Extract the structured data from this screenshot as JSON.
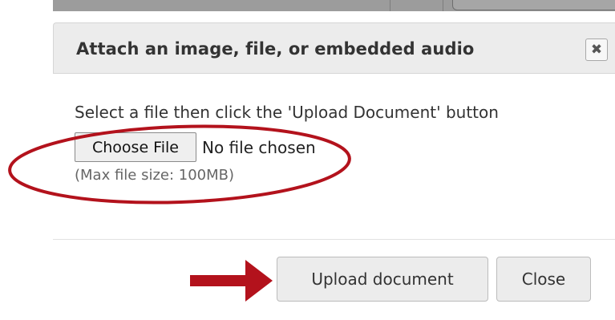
{
  "dialog": {
    "title": "Attach an image, file, or embedded audio",
    "close_icon_glyph": "✖"
  },
  "upload": {
    "instruction": "Select a file then click the 'Upload Document' button",
    "choose_file_label": "Choose File",
    "no_file_text": "No file chosen",
    "max_size_text": "(Max file size: 100MB)"
  },
  "footer": {
    "upload_label": "Upload document",
    "close_label": "Close"
  },
  "icons": {
    "close": "close-icon",
    "annotation_arrow": "arrow-right-icon"
  },
  "colors": {
    "annotation_red": "#b3121c",
    "header_bg": "#ececec",
    "button_bg": "#ececec"
  }
}
